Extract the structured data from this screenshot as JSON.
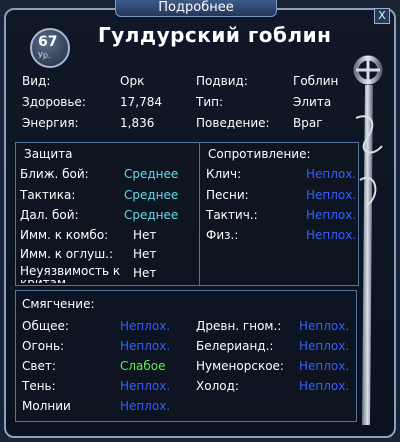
{
  "window": {
    "title": "Подробнее",
    "close_symbol": "X"
  },
  "header": {
    "level_value": "67",
    "level_label": "Ур.",
    "name": "Гулдурский гоблин"
  },
  "info": {
    "rows": [
      {
        "label": "Вид:",
        "value": "Орк",
        "label2": "Подвид:",
        "value2": "Гоблин"
      },
      {
        "label": "Здоровье:",
        "value": "17,784",
        "label2": "Тип:",
        "value2": "Элита"
      },
      {
        "label": "Энергия:",
        "value": "1,836",
        "label2": "Поведение:",
        "value2": "Враг"
      }
    ]
  },
  "defense": {
    "title": "Защита",
    "rows": [
      {
        "label": "Ближ. бой:",
        "value": "Среднее"
      },
      {
        "label": "Тактика:",
        "value": "Среднее"
      },
      {
        "label": "Дал. бой:",
        "value": "Среднее"
      },
      {
        "label": "Имм. к комбо:",
        "value": "Нет"
      },
      {
        "label": "Имм. к оглуш.:",
        "value": "Нет"
      },
      {
        "label": "Неуязвимость к",
        "label_cont": "критам",
        "value": "Нет"
      }
    ]
  },
  "resist": {
    "title": "Сопротивление:",
    "rows": [
      {
        "label": "Клич:",
        "value": "Неплох."
      },
      {
        "label": "Песни:",
        "value": "Неплох."
      },
      {
        "label": "Тактич.:",
        "value": "Неплох."
      },
      {
        "label": "Физ.:",
        "value": "Неплох."
      }
    ]
  },
  "mitigation": {
    "title": "Смягчение:",
    "left": [
      {
        "label": "Общее:",
        "value": "Неплох."
      },
      {
        "label": "Огонь:",
        "value": "Неплох."
      },
      {
        "label": "Свет:",
        "value": "Слабое"
      },
      {
        "label": "Тень:",
        "value": "Неплох."
      },
      {
        "label": "Молнии",
        "value": "Неплох."
      }
    ],
    "right": [
      {
        "label": "Древн. гном.:",
        "value": "Неплох."
      },
      {
        "label": "Белерианд.:",
        "value": "Неплох."
      },
      {
        "label": "Нуменорское:",
        "value": "Неплох."
      },
      {
        "label": "Холод:",
        "value": "Неплох."
      }
    ]
  },
  "colors": {
    "good": "#68d7ef",
    "bad": "#355fff",
    "weak": "#5ff04d"
  }
}
